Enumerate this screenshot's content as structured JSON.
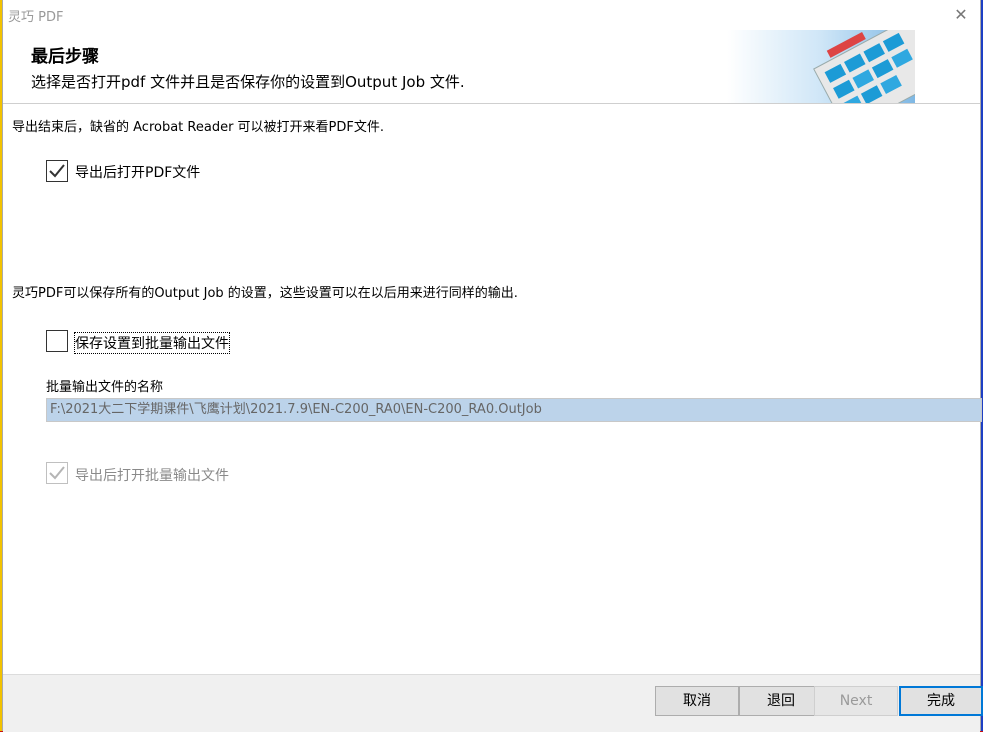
{
  "window": {
    "title": "灵巧 PDF",
    "close_glyph": "✕"
  },
  "header": {
    "title": "最后步骤",
    "subtitle": "选择是否打开pdf 文件并且是否保存你的设置到Output Job 文件."
  },
  "content": {
    "intro_text": "导出结束后，缺省的 Acrobat Reader 可以被打开来看PDF文件.",
    "open_pdf_label": "导出后打开PDF文件",
    "open_pdf_checked": true,
    "save_info_text": "灵巧PDF可以保存所有的Output Job 的设置，这些设置可以在以后用来进行同样的输出.",
    "save_settings_label": "保存设置到批量输出文件",
    "save_settings_checked": false,
    "batch_name_label": "批量输出文件的名称",
    "batch_file_path": "F:\\2021大二下学期课件\\飞鹰计划\\2021.7.9\\EN-C200_RA0\\EN-C200_RA0.OutJob",
    "open_batch_label": "导出后打开批量输出文件",
    "open_batch_checked": true
  },
  "footer": {
    "cancel": "取消",
    "back": "退回",
    "next": "Next",
    "finish": "完成"
  },
  "colors": {
    "accent": "#0078d7",
    "path_field_bg": "#bcd3ea"
  }
}
